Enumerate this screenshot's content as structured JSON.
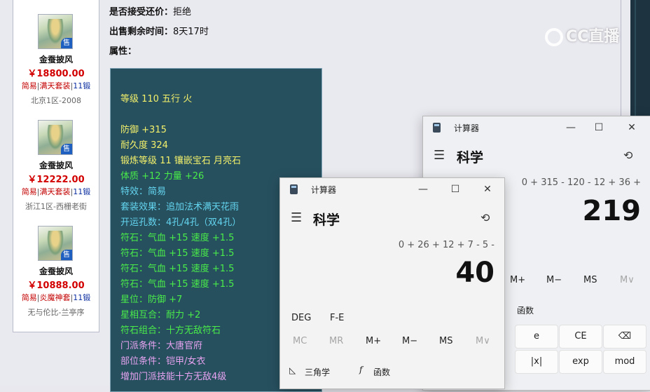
{
  "sidebar": {
    "items": [
      {
        "name": "金蚕披风",
        "price": "￥18800.00",
        "tags": [
          "简易",
          "满天套装",
          "11锻"
        ],
        "server": "北京1区-2008",
        "badge": "售"
      },
      {
        "name": "金蚕披风",
        "price": "￥12222.00",
        "tags": [
          "简易",
          "满天套装",
          "11锻"
        ],
        "server": "浙江1区-西栅老街",
        "badge": "售"
      },
      {
        "name": "金蚕披风",
        "price": "￥10888.00",
        "tags": [
          "简易",
          "炎魔神套",
          "11锻"
        ],
        "server": "无与伦比-兰亭序",
        "badge": "售"
      }
    ]
  },
  "info": {
    "counter_offer_label": "是否接受还价：",
    "counter_offer_value": "拒绝",
    "remaining_label": "出售剩余时间：",
    "remaining_value": "8天17时",
    "attr_label": "属性："
  },
  "attributes": [
    "等级 110 五行 火",
    "防御 +315",
    "耐久度 324",
    "锻炼等级 11 镶嵌宝石 月亮石",
    "体质 +12 力量 +26",
    "特效：简易",
    "套装效果：追加法术满天花雨",
    "开运孔数：4孔/4孔（双4孔）",
    "符石：气血 +15 速度 +1.5",
    "符石：气血 +15 速度 +1.5",
    "符石：气血 +15 速度 +1.5",
    "符石：气血 +15 速度 +1.5",
    "星位：防御 +7",
    "星相互合：耐力 +2",
    "符石组合：十方无敌符石",
    "门派条件：大唐官府",
    "部位条件：铠甲/女衣",
    "增加门派技能十方无敌4级"
  ],
  "colors": {
    "yellow": "#f3f06a",
    "cyan": "#63d4ee",
    "green": "#49ec49",
    "pink": "#e7a3f0",
    "price_red": "#d20000",
    "box_bg": "#27505f"
  },
  "watermark": "CC直播",
  "calc_back": {
    "title": "计算器",
    "mode": "科学",
    "expression": "0 + 315 - 120 - 12 + 36 +",
    "result": "219",
    "mem": [
      "M+",
      "M−",
      "MS",
      "M∨"
    ],
    "fn_label": "函数",
    "keys": [
      "e",
      "CE",
      "⌫",
      "|x|",
      "exp",
      "mod"
    ]
  },
  "calc_front": {
    "title": "计算器",
    "mode": "科学",
    "expression": "0 + 26 + 12 + 7 - 5 -",
    "result": "40",
    "angle": "DEG",
    "fe": "F-E",
    "mem": [
      "MC",
      "MR",
      "M+",
      "M−",
      "MS",
      "M∨"
    ],
    "trig_label": "三角学",
    "fn_label": "函数"
  },
  "icons": {
    "minimize": "—",
    "maximize": "☐",
    "close": "✕",
    "history": "⟲",
    "hamburger": "☰"
  }
}
